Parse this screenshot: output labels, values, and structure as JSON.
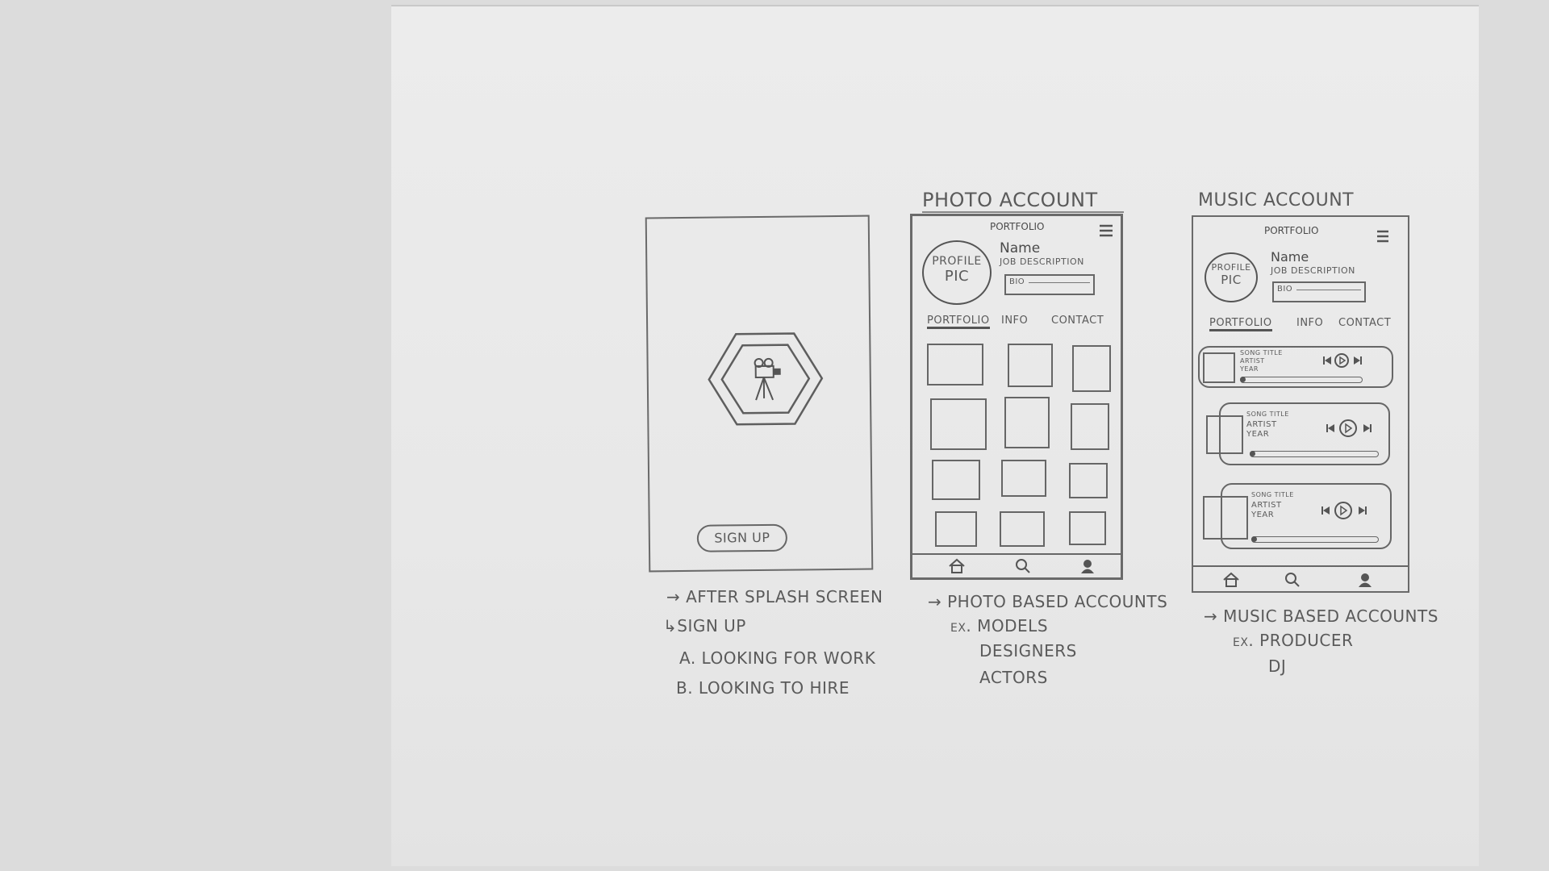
{
  "screens": {
    "signup": {
      "button_label": "SIGN UP",
      "notes": [
        "→ AFTER SPLASH SCREEN",
        "↳SIGN UP",
        "A. LOOKING FOR WORK",
        "B. LOOKING TO HIRE"
      ]
    },
    "photo": {
      "heading": "PHOTO ACCOUNT",
      "header_title": "PORTFOLIO",
      "profile_pic": [
        "PROFILE",
        "PIC"
      ],
      "name": "Name",
      "job": "JOB DESCRIPTION",
      "bio": "BIO",
      "tabs": [
        "PORTFOLIO",
        "INFO",
        "CONTACT"
      ],
      "notes": [
        "→ PHOTO BASED ACCOUNTS",
        "ex. MODELS",
        "DESIGNERS",
        "ACTORS"
      ]
    },
    "music": {
      "heading": "MUSIC ACCOUNT",
      "header_title": "PORTFOLIO",
      "profile_pic": [
        "PROFILE",
        "PIC"
      ],
      "name": "Name",
      "job": "JOB DESCRIPTION",
      "bio": "BIO",
      "tabs": [
        "PORTFOLIO",
        "INFO",
        "CONTACT"
      ],
      "songs": [
        {
          "title": "SONG TITLE",
          "artist": "ARTIST",
          "year": "YEAR"
        },
        {
          "title": "SONG TITLE",
          "artist": "ARTIST",
          "year": "YEAR"
        },
        {
          "title": "SONG TITLE",
          "artist": "ARTIST",
          "year": "YEAR"
        }
      ],
      "notes": [
        "→ MUSIC BASED ACCOUNTS",
        "ex. PRODUCER",
        "DJ"
      ]
    }
  },
  "icons": [
    "camera-tripod-icon",
    "hamburger-menu-icon",
    "home-icon",
    "search-icon",
    "profile-icon",
    "prev-icon",
    "play-icon",
    "next-icon"
  ]
}
